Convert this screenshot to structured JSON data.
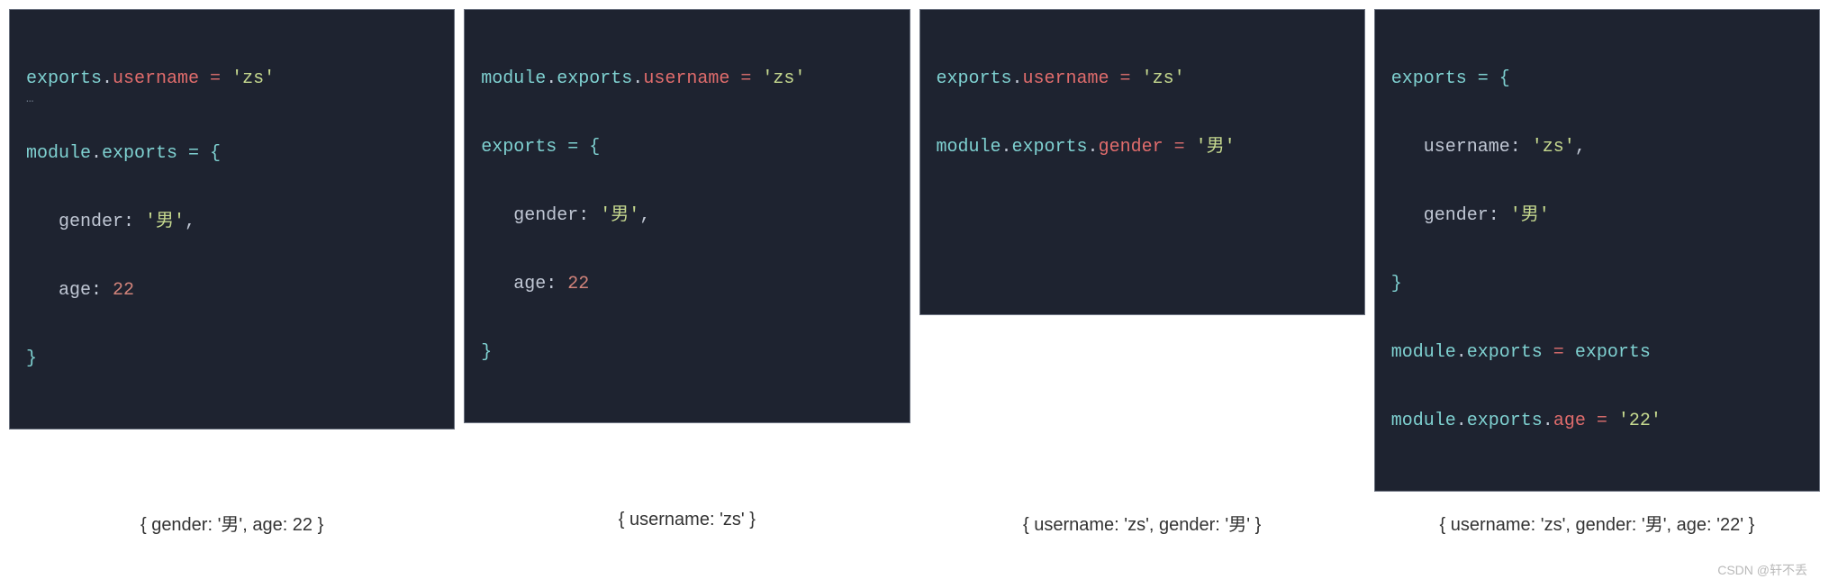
{
  "panels": [
    {
      "code": {
        "l1_a": "exports",
        "l1_b": ".",
        "l1_c": "username",
        "l1_d": " = ",
        "l1_e": "'zs'",
        "ell": "…",
        "l2_a": "module",
        "l2_b": ".",
        "l2_c": "exports",
        "l2_d": " = {",
        "l3_a": "   gender",
        "l3_b": ": ",
        "l3_c": "'男'",
        "l3_d": ",",
        "l4_a": "   age",
        "l4_b": ": ",
        "l4_c": "22",
        "l5_a": "}"
      },
      "caption": "{ gender: '男', age: 22 }"
    },
    {
      "code": {
        "l1_a": "module",
        "l1_b": ".",
        "l1_c": "exports",
        "l1_d": ".",
        "l1_e": "username",
        "l1_f": " = ",
        "l1_g": "'zs'",
        "l2_a": "exports",
        "l2_b": " = {",
        "l3_a": "   gender",
        "l3_b": ": ",
        "l3_c": "'男'",
        "l3_d": ",",
        "l4_a": "   age",
        "l4_b": ": ",
        "l4_c": "22",
        "l5_a": "}"
      },
      "caption": "{ username: 'zs' }"
    },
    {
      "code": {
        "l1_a": "exports",
        "l1_b": ".",
        "l1_c": "username",
        "l1_d": " = ",
        "l1_e": "'zs'",
        "l2_a": "module",
        "l2_b": ".",
        "l2_c": "exports",
        "l2_d": ".",
        "l2_e": "gender",
        "l2_f": " = ",
        "l2_g": "'男'"
      },
      "caption": "{ username: 'zs', gender: '男' }"
    },
    {
      "code": {
        "l1_a": "exports",
        "l1_b": " = {",
        "l2_a": "   username",
        "l2_b": ": ",
        "l2_c": "'zs'",
        "l2_d": ",",
        "l3_a": "   gender",
        "l3_b": ": ",
        "l3_c": "'男'",
        "l4_a": "}",
        "l5_a": "module",
        "l5_b": ".",
        "l5_c": "exports",
        "l5_d": " = ",
        "l5_e": "exports",
        "l6_a": "module",
        "l6_b": ".",
        "l6_c": "exports",
        "l6_d": ".",
        "l6_e": "age",
        "l6_f": " = ",
        "l6_g": "'22'"
      },
      "caption": "{ username: 'zs', gender: '男', age: '22' }"
    }
  ],
  "watermark": "CSDN @轩不丢"
}
